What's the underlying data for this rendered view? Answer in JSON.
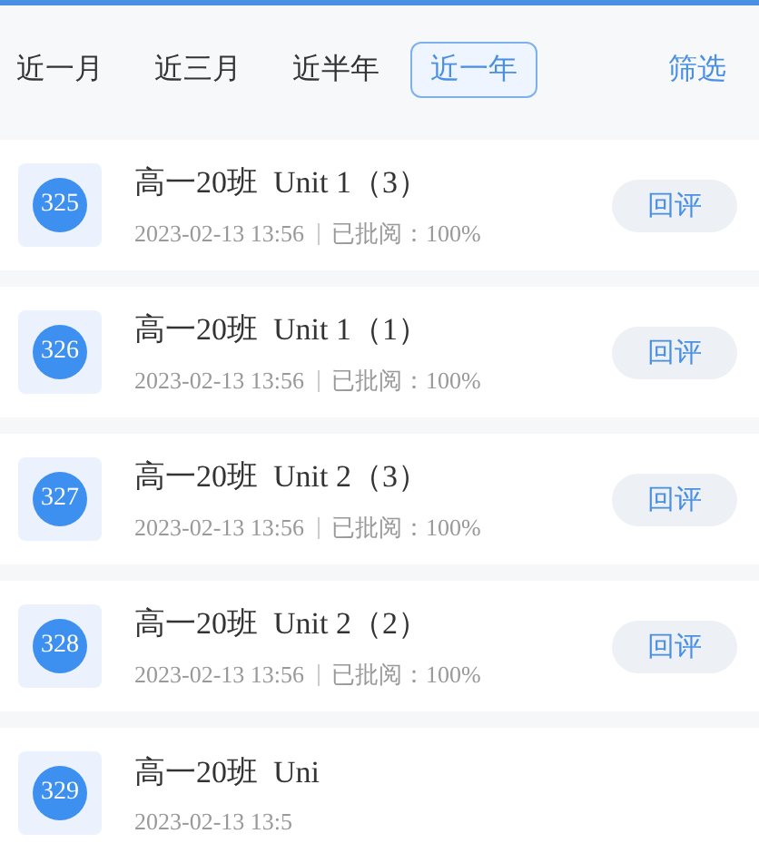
{
  "filters": [
    {
      "label": "近一月",
      "selected": false
    },
    {
      "label": "近三月",
      "selected": false
    },
    {
      "label": "近半年",
      "selected": false
    },
    {
      "label": "近一年",
      "selected": true
    }
  ],
  "filter_action": "筛选",
  "records": [
    {
      "number": "325",
      "title": "高一20班  Unit 1（3）",
      "time": "2023-02-13 13:56",
      "status": "已批阅：100%",
      "button": "回评"
    },
    {
      "number": "326",
      "title": "高一20班  Unit 1（1）",
      "time": "2023-02-13 13:56",
      "status": "已批阅：100%",
      "button": "回评"
    },
    {
      "number": "327",
      "title": "高一20班  Unit 2（3）",
      "time": "2023-02-13 13:56",
      "status": "已批阅：100%",
      "button": "回评"
    },
    {
      "number": "328",
      "title": "高一20班  Unit 2（2）",
      "time": "2023-02-13 13:56",
      "status": "已批阅：100%",
      "button": "回评"
    },
    {
      "number": "329",
      "title": "高一20班  Uni",
      "time": "2023-02-13 13:5"
    }
  ]
}
